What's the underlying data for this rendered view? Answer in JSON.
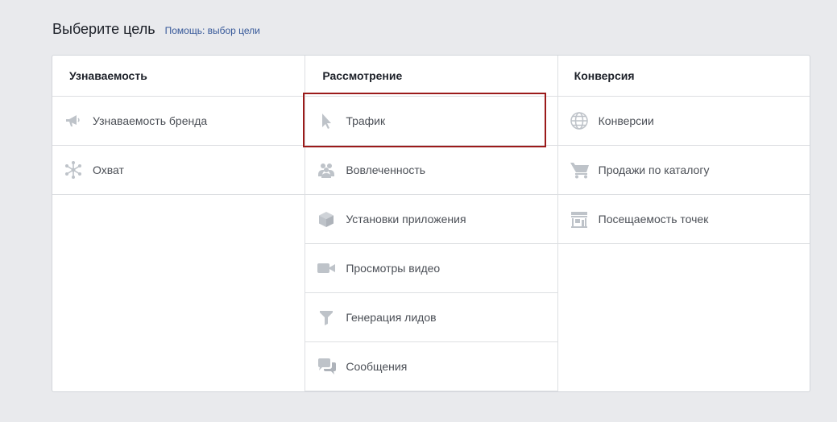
{
  "header": {
    "title": "Выберите цель",
    "help_link": "Помощь: выбор цели"
  },
  "colors": {
    "icon": "#bec3c9",
    "selected_frame": "#9b1a1a",
    "link": "#365899"
  },
  "columns": [
    {
      "heading": "Узнаваемость",
      "items": [
        {
          "label": "Узнаваемость бренда",
          "icon": "megaphone-icon"
        },
        {
          "label": "Охват",
          "icon": "reach-star-icon"
        }
      ]
    },
    {
      "heading": "Рассмотрение",
      "items": [
        {
          "label": "Трафик",
          "icon": "cursor-icon",
          "selected": true
        },
        {
          "label": "Вовлеченность",
          "icon": "people-icon"
        },
        {
          "label": "Установки приложения",
          "icon": "cube-icon"
        },
        {
          "label": "Просмотры видео",
          "icon": "video-camera-icon"
        },
        {
          "label": "Генерация лидов",
          "icon": "funnel-icon"
        },
        {
          "label": "Сообщения",
          "icon": "chat-bubbles-icon"
        }
      ]
    },
    {
      "heading": "Конверсия",
      "items": [
        {
          "label": "Конверсии",
          "icon": "globe-icon"
        },
        {
          "label": "Продажи по каталогу",
          "icon": "shopping-cart-icon"
        },
        {
          "label": "Посещаемость точек",
          "icon": "storefront-icon"
        }
      ]
    }
  ]
}
